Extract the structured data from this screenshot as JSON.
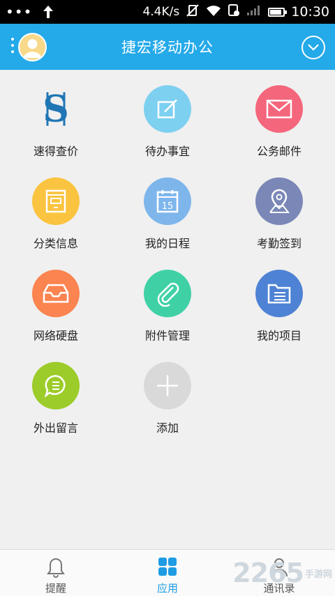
{
  "status_bar": {
    "speed": "4.4K/s",
    "time": "10:30"
  },
  "header": {
    "title": "捷宏移动办公"
  },
  "apps": [
    {
      "label": "速得查价",
      "icon": "dollar-logo-icon",
      "color": "#ffffff"
    },
    {
      "label": "待办事宜",
      "icon": "edit-icon",
      "color": "#7dd0f0"
    },
    {
      "label": "公务邮件",
      "icon": "mail-icon",
      "color": "#f4667c"
    },
    {
      "label": "分类信息",
      "icon": "book-icon",
      "color": "#fbc440"
    },
    {
      "label": "我的日程",
      "icon": "calendar-icon",
      "color": "#7eb6ec"
    },
    {
      "label": "考勤签到",
      "icon": "location-pin-icon",
      "color": "#7a87b7"
    },
    {
      "label": "网络硬盘",
      "icon": "inbox-tray-icon",
      "color": "#fb8450"
    },
    {
      "label": "附件管理",
      "icon": "paperclip-icon",
      "color": "#3fd1a5"
    },
    {
      "label": "我的项目",
      "icon": "project-folder-icon",
      "color": "#4e82d4"
    },
    {
      "label": "外出留言",
      "icon": "chat-bubble-icon",
      "color": "#9ccc2a"
    },
    {
      "label": "添加",
      "icon": "plus-icon",
      "color": "#d9d9d9"
    }
  ],
  "calendar_day": "15",
  "bottom_nav": [
    {
      "label": "提醒",
      "icon": "bell-icon"
    },
    {
      "label": "应用",
      "icon": "grid-apps-icon",
      "active": true
    },
    {
      "label": "通讯录",
      "icon": "contacts-icon"
    }
  ],
  "watermark": {
    "number": "2265",
    "text": "手游网"
  },
  "colors": {
    "header": "#24a9e9",
    "active_tab": "#1d9ce3"
  }
}
